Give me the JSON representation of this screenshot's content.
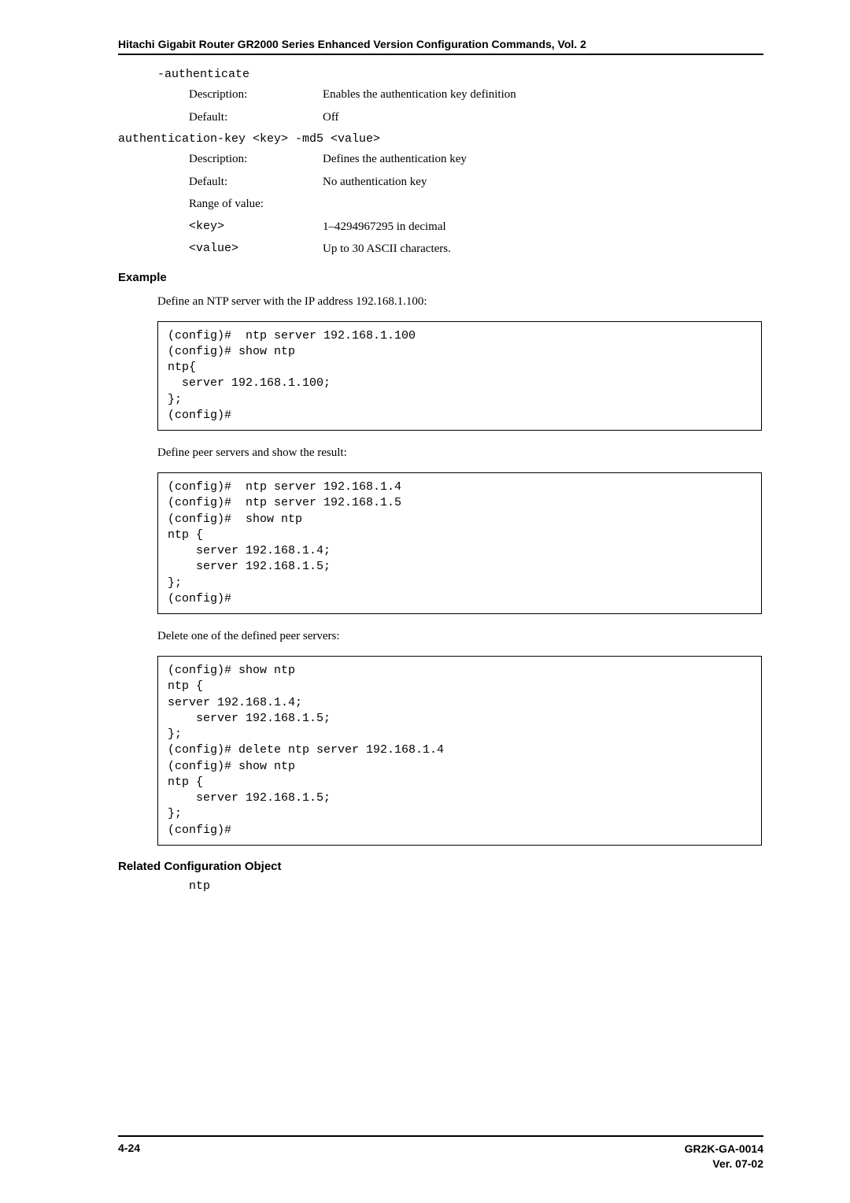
{
  "header": {
    "running_title": "Hitachi Gigabit Router GR2000 Series Enhanced Version Configuration Commands, Vol. 2"
  },
  "params": {
    "authenticate": {
      "name": "-authenticate",
      "desc_label": "Description:",
      "desc_value": "Enables the authentication key definition",
      "default_label": "Default:",
      "default_value": "Off"
    },
    "authkey": {
      "name": "authentication-key <key> -md5 <value>",
      "desc_label": "Description:",
      "desc_value": "Defines the authentication key",
      "default_label": "Default:",
      "default_value": "No authentication key",
      "range_label": "Range of value:",
      "key_label": "<key>",
      "key_value": "1–4294967295 in decimal",
      "value_label": "<value>",
      "value_value": "Up to 30 ASCII characters."
    }
  },
  "sections": {
    "example_heading": "Example",
    "example_intro1": "Define an NTP server with the IP address 192.168.1.100:",
    "codebox1": "(config)#  ntp server 192.168.1.100\n(config)# show ntp\nntp{\n  server 192.168.1.100;\n};\n(config)#",
    "example_intro2": "Define peer servers and show the result:",
    "codebox2": "(config)#  ntp server 192.168.1.4\n(config)#  ntp server 192.168.1.5\n(config)#  show ntp\nntp {\n    server 192.168.1.4;\n    server 192.168.1.5;\n};\n(config)#",
    "example_intro3": "Delete one of the defined peer servers:",
    "codebox3": "(config)# show ntp\nntp {\nserver 192.168.1.4;\n    server 192.168.1.5;\n};\n(config)# delete ntp server 192.168.1.4\n(config)# show ntp\nntp {\n    server 192.168.1.5;\n};\n(config)#",
    "related_heading": "Related Configuration Object",
    "related_value": "ntp"
  },
  "footer": {
    "page_num": "4-24",
    "doc_id": "GR2K-GA-0014",
    "version": "Ver. 07-02"
  }
}
